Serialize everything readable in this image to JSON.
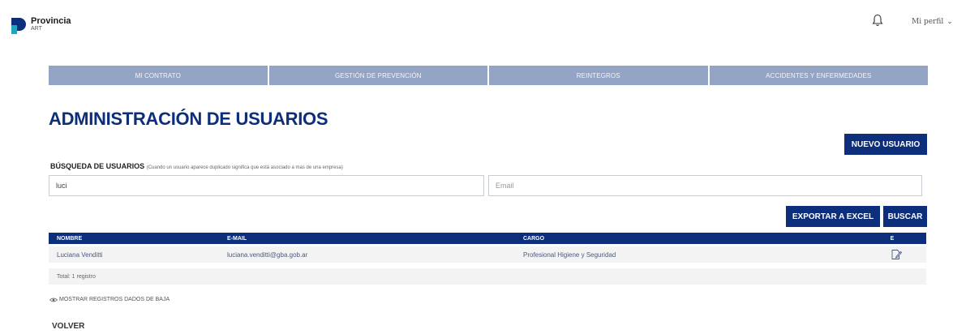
{
  "header": {
    "brand_name": "Provincia",
    "brand_sub": "ART",
    "profile_label": "Mi perfil"
  },
  "nav": {
    "items": [
      {
        "label": "MI CONTRATO"
      },
      {
        "label": "GESTIÓN DE PREVENCIÓN"
      },
      {
        "label": "REINTEGROS"
      },
      {
        "label": "ACCIDENTES Y ENFERMEDADES"
      }
    ]
  },
  "page": {
    "title": "ADMINISTRACIÓN DE USUARIOS",
    "new_user_label": "NUEVO USUARIO"
  },
  "search": {
    "heading": "BÚSQUEDA DE USUARIOS",
    "note": "(Cuando un usuario aparece duplicado significa que está asociado a mas de una empresa)",
    "name_value": "luci",
    "email_value": "",
    "email_placeholder": "Email",
    "export_label": "EXPORTAR A EXCEL",
    "search_label": "BUSCAR"
  },
  "table": {
    "columns": [
      "NOMBRE",
      "E-MAIL",
      "CARGO",
      "E"
    ],
    "rows": [
      {
        "nombre": "Luciana Venditti",
        "email": "luciana.venditti@gba.gob.ar",
        "cargo": "Profesional Higiene y Seguridad"
      }
    ],
    "total": "Total: 1 registro"
  },
  "footer": {
    "show_deleted_label": "MOSTRAR REGISTROS DADOS DE BAJA",
    "back_label": "VOLVER"
  },
  "colors": {
    "primary": "#0d2e7a",
    "nav_bg": "#94a4c4",
    "row_bg": "#f3f3f3"
  },
  "icons": {
    "logo": "provincia-logo-icon",
    "bell": "bell-icon",
    "chevron": "chevron-down-icon",
    "edit": "edit-icon",
    "eye": "eye-icon"
  }
}
